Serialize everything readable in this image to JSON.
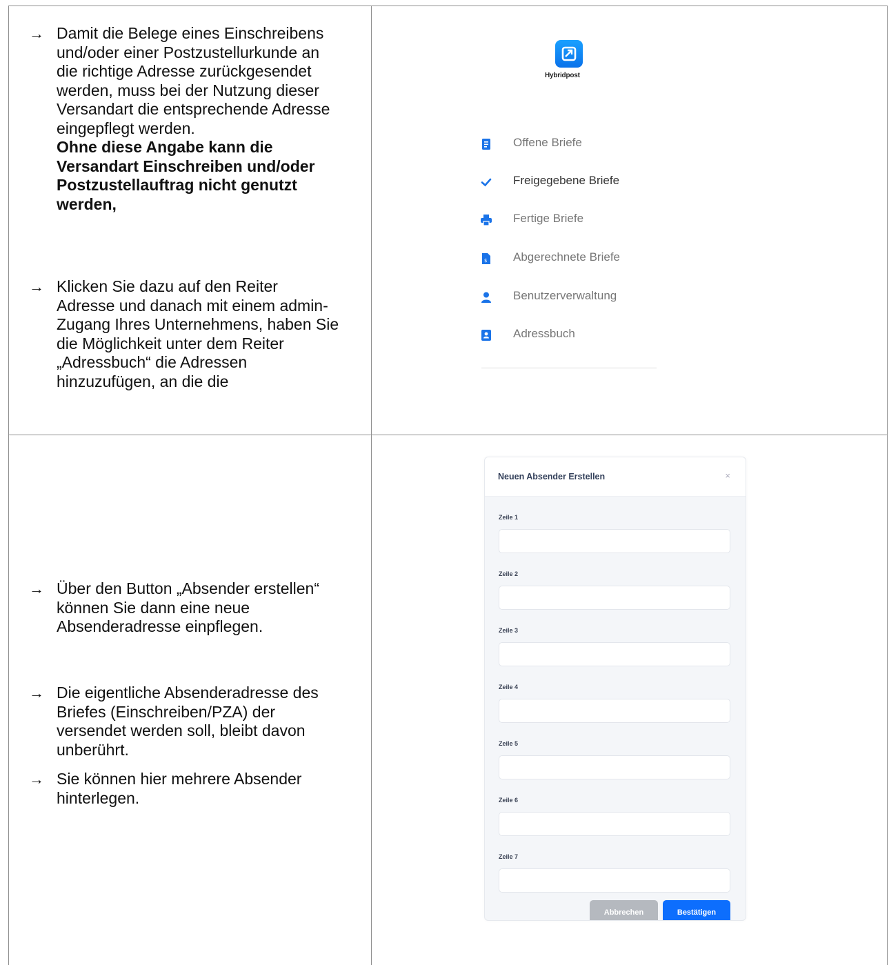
{
  "text_top": {
    "p1": "Damit die Belege eines Einschreibens und/oder einer Postzustellurkunde an die richtige Adresse zurückgesendet werden, muss bei der Nutzung dieser Versandart die entsprechende Adresse eingepflegt werden.",
    "p1_bold": "Ohne diese Angabe kann die Versandart Einschreiben und/oder Postzustellauftrag nicht genutzt werden,",
    "p2": "Klicken Sie dazu auf den Reiter Adresse und danach mit einem admin-Zugang Ihres Unternehmens, haben Sie die Möglichkeit unter dem Reiter „Adressbuch“ die Adressen hinzuzufügen, an die die"
  },
  "text_bottom": {
    "p3": "Über den Button „Absender erstellen“ können Sie dann eine neue Absenderadresse einpflegen.",
    "p4": "Die eigentliche Absenderadresse des Briefes (Einschreiben/PZA) der versendet werden soll, bleibt davon unberührt.",
    "p5": "Sie können hier mehrere Absender hinterlegen."
  },
  "arrow_glyph": "→",
  "app": {
    "logo_text": "Hybridpost",
    "accent_color": "#1a73e8",
    "nav": [
      {
        "label": "Offene Briefe",
        "icon": "document-icon",
        "active": false
      },
      {
        "label": "Freigegebene Briefe",
        "icon": "checkmark-icon",
        "active": true
      },
      {
        "label": "Fertige Briefe",
        "icon": "printer-icon",
        "active": false
      },
      {
        "label": "Abgerechnete Briefe",
        "icon": "invoice-icon",
        "active": false
      },
      {
        "label": "Benutzerverwaltung",
        "icon": "user-icon",
        "active": false
      },
      {
        "label": "Adressbuch",
        "icon": "address-book-icon",
        "active": false
      }
    ]
  },
  "modal": {
    "title": "Neuen Absender Erstellen",
    "close_glyph": "×",
    "fields": [
      {
        "label": "Zeile 1",
        "value": ""
      },
      {
        "label": "Zeile 2",
        "value": ""
      },
      {
        "label": "Zeile 3",
        "value": ""
      },
      {
        "label": "Zeile 4",
        "value": ""
      },
      {
        "label": "Zeile 5",
        "value": ""
      },
      {
        "label": "Zeile 6",
        "value": ""
      },
      {
        "label": "Zeile 7",
        "value": ""
      }
    ],
    "cancel_label": "Abbrechen",
    "confirm_label": "Bestätigen"
  }
}
